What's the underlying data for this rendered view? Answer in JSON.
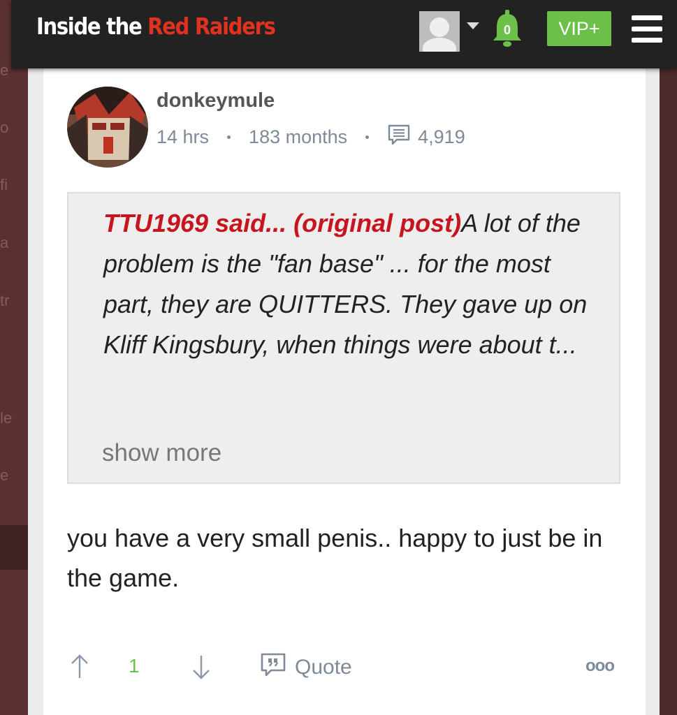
{
  "header": {
    "brand_part1": "Inside the ",
    "brand_part2": "Red Raiders",
    "notification_count": "0",
    "vip_label": "VIP+"
  },
  "background_page_letters": [
    "e",
    "o",
    "fi",
    "a",
    "tr",
    "le",
    "e"
  ],
  "post": {
    "username": "donkeymule",
    "time_ago": "14 hrs",
    "membership": "183 months",
    "post_count": "4,919",
    "quote": {
      "author_said": "TTU1969 said...",
      "link_open": "(",
      "link_label": "original post",
      "link_close": ")",
      "text": "A lot of the problem is the \"fan base\" ... for the most part, they are QUITTERS. They gave up on Kliff Kingsbury, when things were about t...",
      "show_more": "show more"
    },
    "body": "you have a very small penis.. happy to just be in the game.",
    "vote_count": "1",
    "quote_button": "Quote",
    "more_button": "ooo"
  },
  "colors": {
    "header_bg": "#222222",
    "brand_accent": "#e0321f",
    "vip_green": "#6cc04a",
    "quote_author_red": "#c8141e",
    "meta_gray": "#7d8a9a"
  }
}
